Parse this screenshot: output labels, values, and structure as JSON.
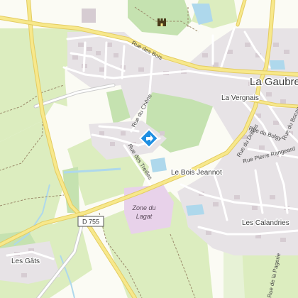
{
  "map": {
    "colors": {
      "background": "#fbfbf4",
      "field": "#dcedbf",
      "forest": "#c5e2b0",
      "urban": "#e7e3e6",
      "industrial_zone": "#e8d2ea",
      "water": "#aed8ec",
      "main_road": "#f7e88b",
      "road_casing": "#e4cc61",
      "street": "#ffffff",
      "building": "#d6ccd2",
      "marker": "#1f8fe2"
    },
    "places": {
      "town": "La Gaubre",
      "hamlet_vergnais": "La Vergnais",
      "hamlet_bois_jeannot": "Le Bois Jeannot",
      "hamlet_calandries": "Les Calandries",
      "hamlet_gats": "Les Gâts",
      "zone_name_line1": "Zone du",
      "zone_name_line2": "Lagat"
    },
    "roads": {
      "route_number": "D 755",
      "rue_des_bois": "Rue des Bois",
      "rue_du_chene": "Rue du Chêne",
      "rue_des_treilles": "Rue des Treilles",
      "rue_du_drillais": "Rue du Drillais",
      "rue_du_bolgy": "Rue du Bolgy",
      "rue_du_bocage": "Rue du Bocage",
      "rue_pierre_rangeard": "Rue Pierre Rangeard",
      "rue_de_la_pagerie": "Rue de la Pagerie"
    },
    "icons": {
      "castle": "castle-icon",
      "location": "location-pin-icon"
    }
  }
}
